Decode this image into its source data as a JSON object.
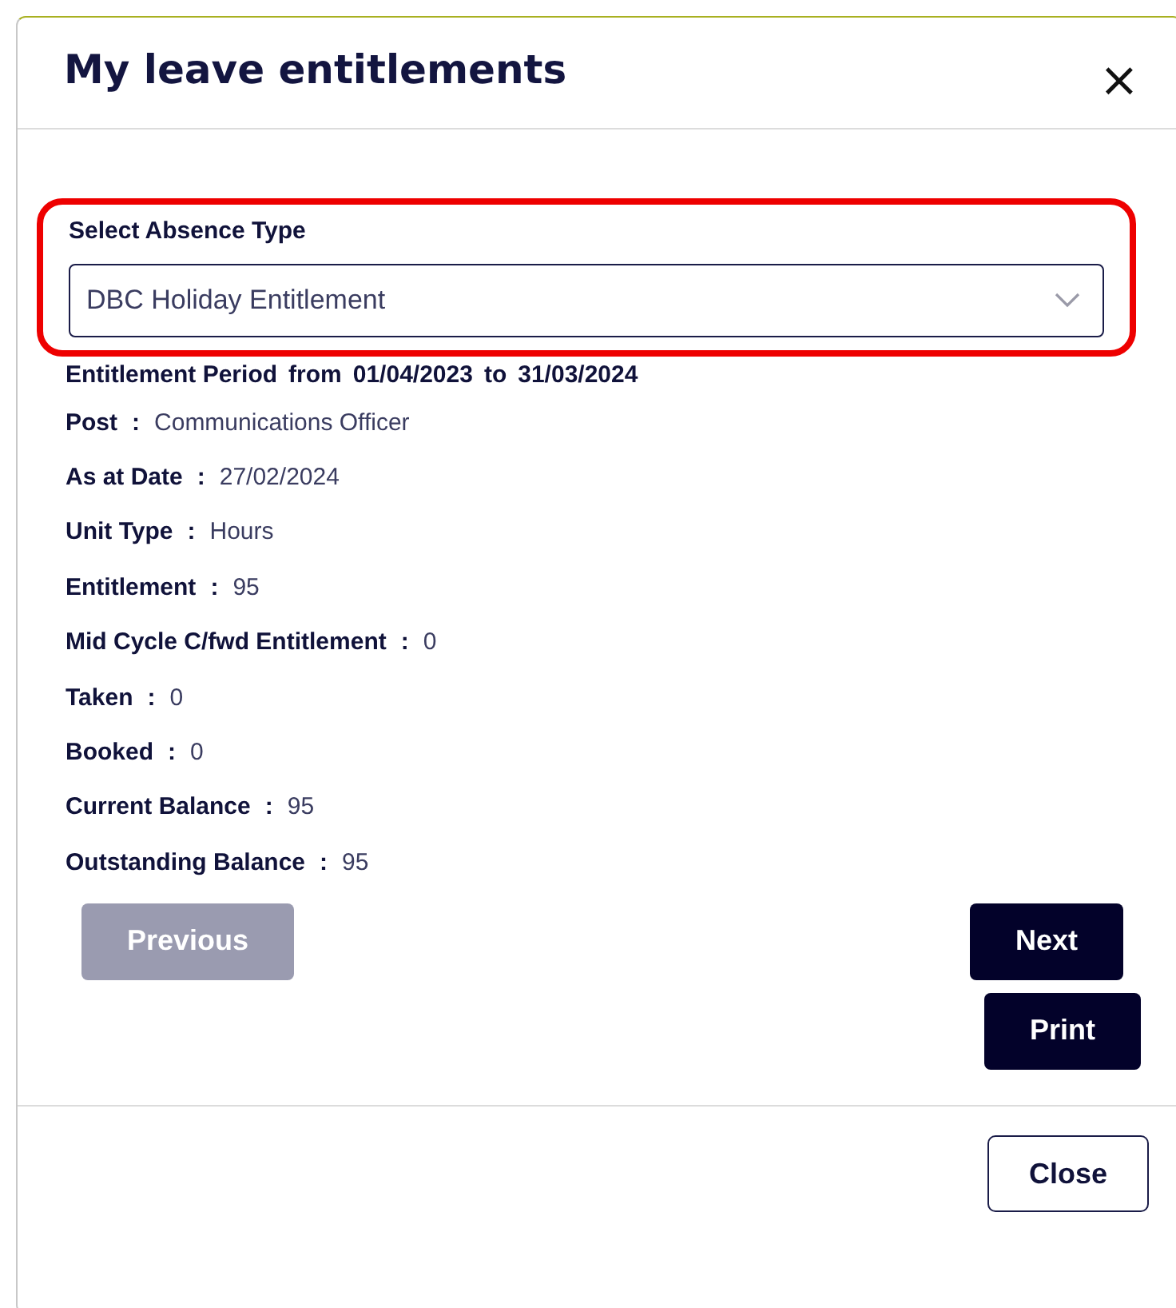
{
  "dialog": {
    "title": "My leave entitlements",
    "close_icon": "×"
  },
  "absence_type": {
    "label": "Select Absence Type",
    "value": "DBC Holiday Entitlement",
    "highlighted": true
  },
  "period": [
    "Entitlement Period",
    "from",
    "01/04/2023",
    "to",
    "31/03/2024"
  ],
  "details": [
    {
      "label": "Post",
      "value": "Communications Officer"
    },
    {
      "label": "As at Date",
      "value": "27/02/2024"
    },
    {
      "label": "Unit Type",
      "value": "Hours"
    },
    {
      "label": "Entitlement",
      "value": "95"
    },
    {
      "label": "Mid Cycle C/fwd Entitlement",
      "value": "0"
    },
    {
      "label": "Taken",
      "value": "0"
    },
    {
      "label": "Booked",
      "value": "0"
    },
    {
      "label": "Current Balance",
      "value": "95"
    },
    {
      "label": "Outstanding Balance",
      "value": "95"
    }
  ],
  "separator": ":",
  "buttons": [
    {
      "label": "Previous",
      "disabled": true
    },
    {
      "label": "Next",
      "disabled": false
    },
    {
      "label": "Print",
      "disabled": false
    }
  ],
  "footer_buttons": [
    "Close"
  ]
}
